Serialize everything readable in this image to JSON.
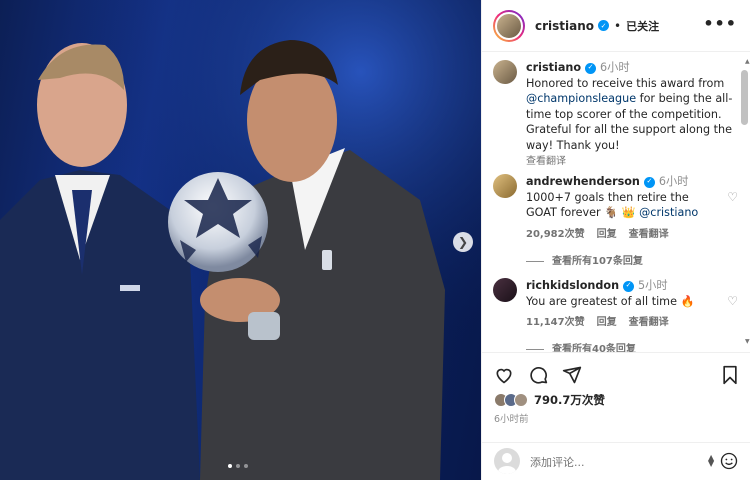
{
  "post": {
    "username": "cristiano",
    "follow_status": "已关注",
    "more_label": "•••",
    "likes": "790.7万次赞",
    "time_ago": "6小时前",
    "image_dots": 3
  },
  "caption": {
    "username": "cristiano",
    "time": "6小时",
    "text_1": "Honored to receive this award from ",
    "mention": "@championsleague",
    "text_2": " for being the all-time top scorer of the competition. Grateful for all the support along the way! Thank you!",
    "translate": "查看翻译"
  },
  "comments": [
    {
      "username": "andrewhenderson",
      "time": "6小时",
      "text": "1000+7 goals then retire the GOAT forever 🐐 👑 ",
      "mention": "@cristiano",
      "likes": "20,982次赞",
      "reply": "回复",
      "translate": "查看翻译",
      "view_replies": "查看所有107条回复"
    },
    {
      "username": "richkidslondon",
      "time": "5小时",
      "text": "You are greatest of all time 🔥",
      "mention": "",
      "likes": "11,147次赞",
      "reply": "回复",
      "translate": "查看翻译",
      "view_replies": "查看所有40条回复"
    }
  ],
  "composer": {
    "placeholder": "添加评论...",
    "sort_icon": "sort-icon",
    "emoji_icon": "emoji-icon"
  },
  "icons": {
    "like": "heart-icon",
    "comment": "comment-icon",
    "share": "paper-plane-icon",
    "save": "bookmark-icon",
    "next": "chevron-right-icon"
  },
  "colors": {
    "verified": "#0095f6",
    "link": "#00376b",
    "muted": "#737373",
    "background_photo": "#0c1f55"
  }
}
